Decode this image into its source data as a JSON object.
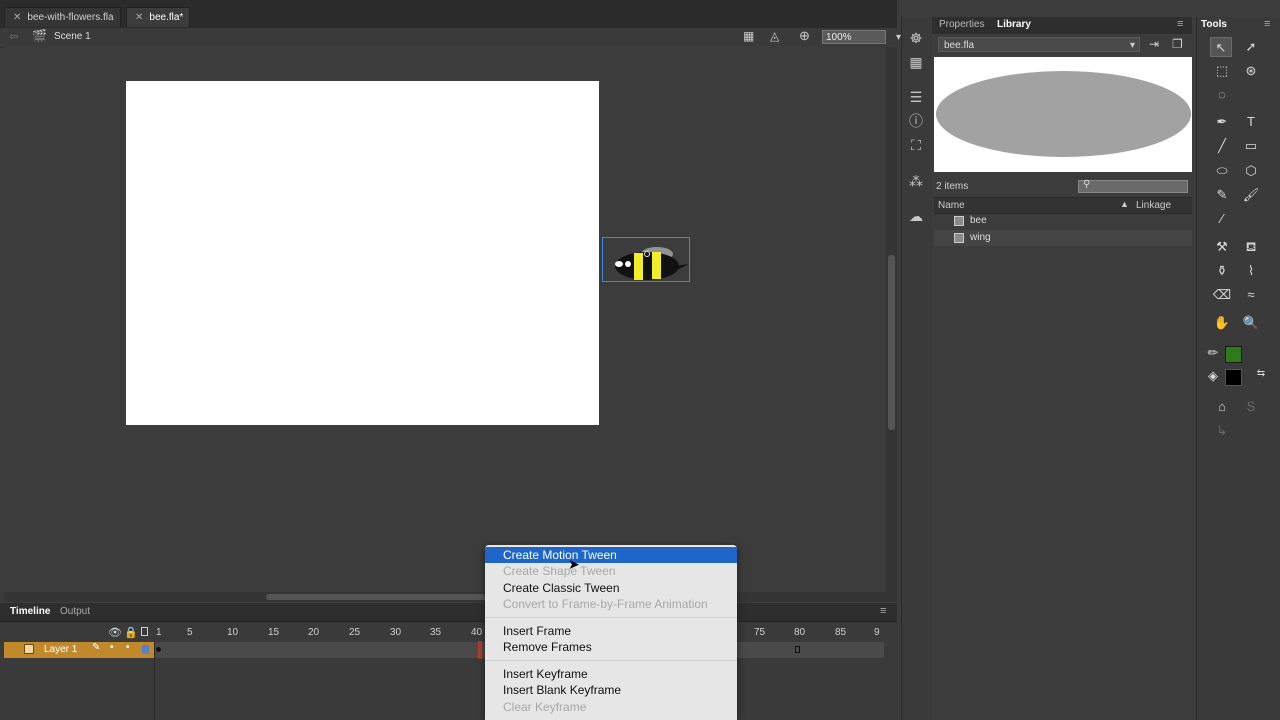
{
  "document_tabs": [
    {
      "label": "bee-with-flowers.fla",
      "active": false
    },
    {
      "label": "bee.fla*",
      "active": true
    }
  ],
  "edit_bar": {
    "scene": "Scene 1",
    "zoom": "100%"
  },
  "timeline": {
    "tabs": [
      "Timeline",
      "Output"
    ],
    "frame_ticks": [
      "1",
      "5",
      "10",
      "15",
      "20",
      "25",
      "30",
      "35",
      "40",
      "75",
      "80",
      "85",
      "9"
    ],
    "layer_name": "Layer 1"
  },
  "context_menu": {
    "items": [
      {
        "label": "Create Motion Tween",
        "state": "highlighted"
      },
      {
        "label": "Create Shape Tween",
        "state": "disabled"
      },
      {
        "label": "Create Classic Tween",
        "state": "enabled"
      },
      {
        "label": "Convert to Frame-by-Frame Animation",
        "state": "disabled"
      },
      {
        "label": "Insert Frame",
        "state": "enabled"
      },
      {
        "label": "Remove Frames",
        "state": "enabled"
      },
      {
        "label": "Insert Keyframe",
        "state": "enabled"
      },
      {
        "label": "Insert Blank Keyframe",
        "state": "enabled"
      },
      {
        "label": "Clear Keyframe",
        "state": "disabled"
      }
    ]
  },
  "library": {
    "tabs": [
      "Properties",
      "Library"
    ],
    "document": "bee.fla",
    "item_count": "2 items",
    "columns": [
      "Name",
      "Linkage"
    ],
    "items": [
      "bee",
      "wing"
    ]
  },
  "tools": {
    "title": "Tools",
    "stroke_color": "#2f7a1a",
    "fill_color": "#000000"
  }
}
